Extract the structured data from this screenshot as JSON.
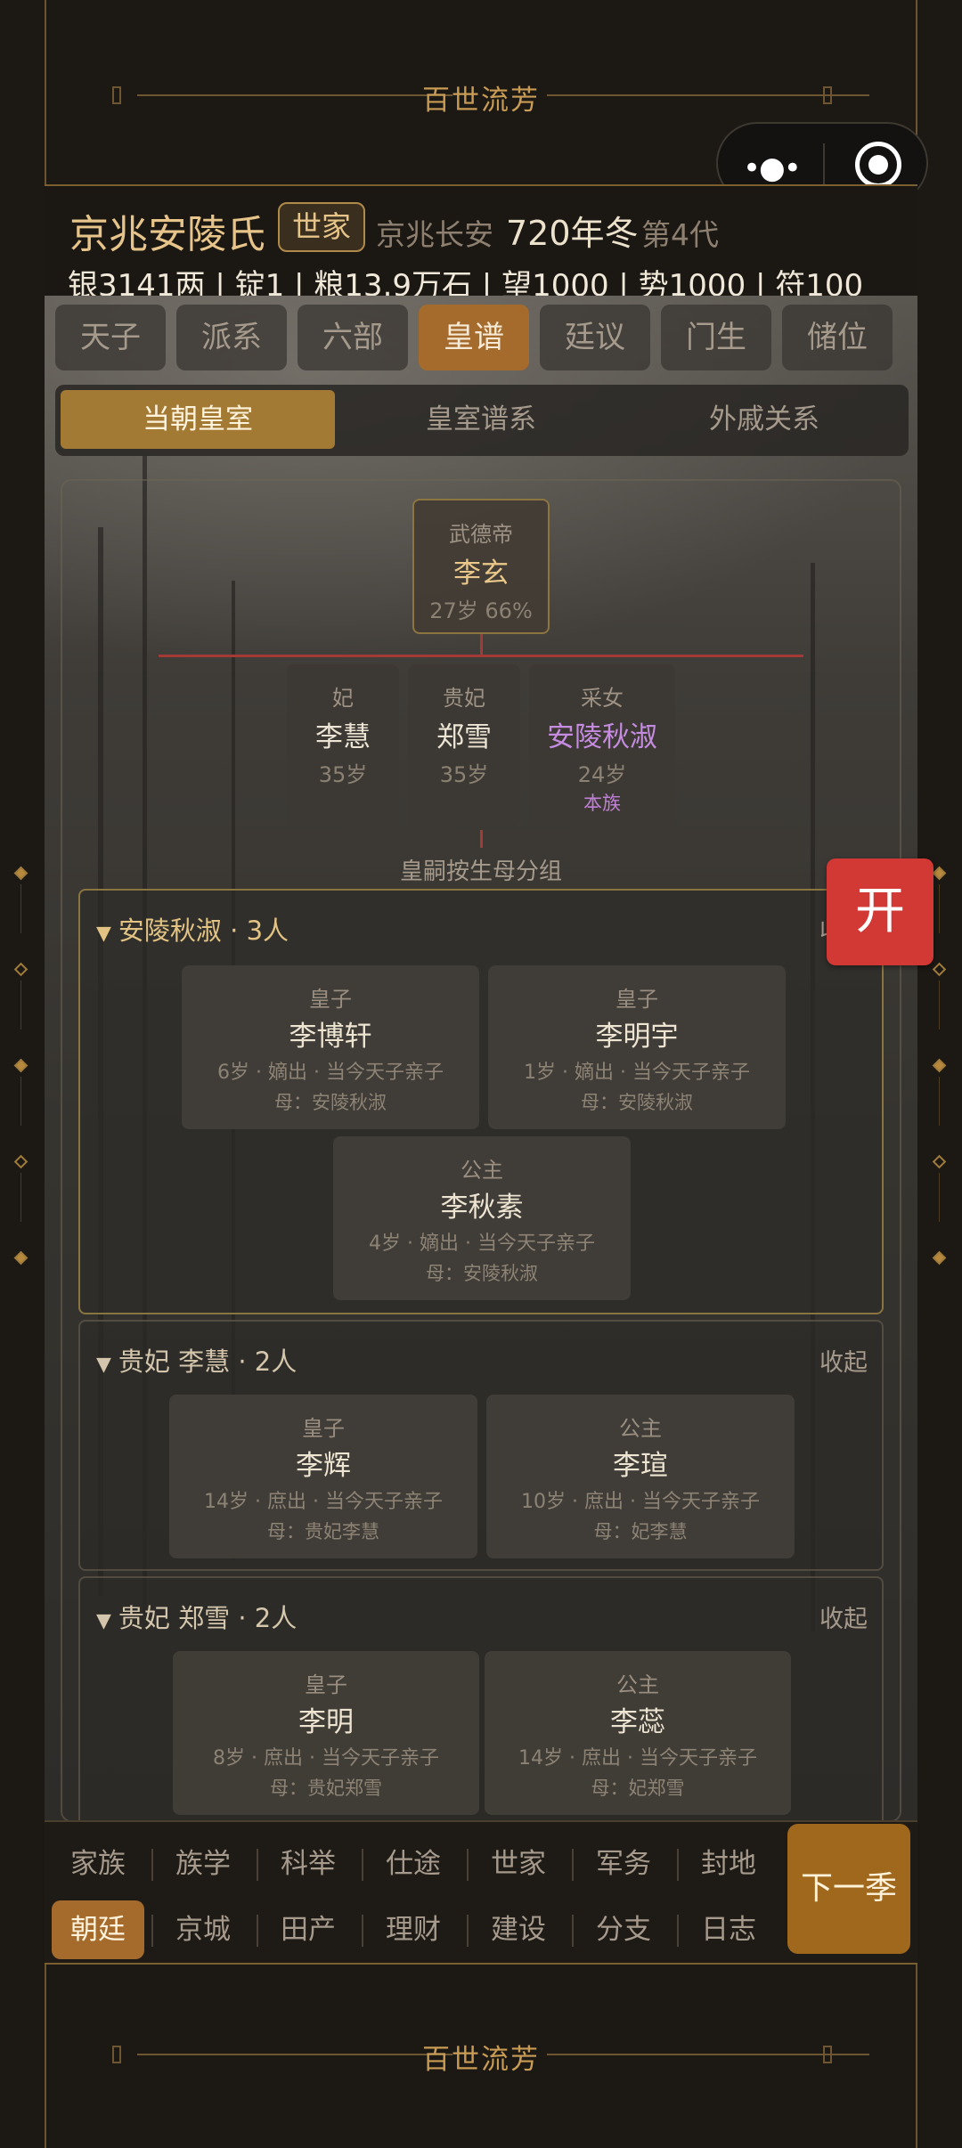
{
  "banner": {
    "text": "百世流芳"
  },
  "header": {
    "family": "京兆安陵氏",
    "rank_badge": "世家",
    "location": "京兆长安",
    "year": "720年冬",
    "generation": "第4代",
    "resources": "银3141两 | 锭1 | 粮13.9万石 | 望1000 | 势1000 | 符100"
  },
  "tabs": [
    "天子",
    "派系",
    "六部",
    "皇谱",
    "廷议",
    "门生",
    "储位"
  ],
  "active_tab": "皇谱",
  "subtabs": [
    "当朝皇室",
    "皇室谱系",
    "外戚关系"
  ],
  "active_subtab": "当朝皇室",
  "emperor": {
    "title": "武德帝",
    "name": "李玄",
    "info": "27岁 66%"
  },
  "consorts": [
    {
      "rank": "妃",
      "name": "李慧",
      "age": "35岁",
      "tag": ""
    },
    {
      "rank": "贵妃",
      "name": "郑雪",
      "age": "35岁",
      "tag": ""
    },
    {
      "rank": "采女",
      "name": "安陵秋淑",
      "age": "24岁",
      "tag": "本族"
    }
  ],
  "group_caption": "皇嗣按生母分组",
  "groups": [
    {
      "header": "安陵秋淑 · 3人",
      "collapse": "收起",
      "children": [
        {
          "role": "皇子",
          "name": "李博轩",
          "detail": "6岁 · 嫡出 · 当今天子亲子",
          "mother": "母：安陵秋淑"
        },
        {
          "role": "皇子",
          "name": "李明宇",
          "detail": "1岁 · 嫡出 · 当今天子亲子",
          "mother": "母：安陵秋淑"
        },
        {
          "role": "公主",
          "name": "李秋素",
          "detail": "4岁 · 嫡出 · 当今天子亲子",
          "mother": "母：安陵秋淑"
        }
      ]
    },
    {
      "header": "贵妃 李慧 · 2人",
      "collapse": "收起",
      "children": [
        {
          "role": "皇子",
          "name": "李辉",
          "detail": "14岁 · 庶出 · 当今天子亲子",
          "mother": "母：贵妃李慧"
        },
        {
          "role": "公主",
          "name": "李瑄",
          "detail": "10岁 · 庶出 · 当今天子亲子",
          "mother": "母：妃李慧"
        }
      ]
    },
    {
      "header": "贵妃 郑雪 · 2人",
      "collapse": "收起",
      "children": [
        {
          "role": "皇子",
          "name": "李明",
          "detail": "8岁 · 庶出 · 当今天子亲子",
          "mother": "母：贵妃郑雪"
        },
        {
          "role": "公主",
          "name": "李蕊",
          "detail": "14岁 · 庶出 · 当今天子亲子",
          "mother": "母：妃郑雪"
        }
      ]
    }
  ],
  "open_button": "开",
  "bottom_nav": {
    "row1": [
      "家族",
      "族学",
      "科举",
      "仕途",
      "世家",
      "军务",
      "封地"
    ],
    "row2": [
      "朝廷",
      "京城",
      "田产",
      "理财",
      "建设",
      "分支",
      "日志"
    ],
    "active": "朝廷",
    "next": "下一季"
  },
  "colors": {
    "accent": "#a46b2c",
    "gold": "#e6c48a",
    "red": "#d23834",
    "purple": "#c58be0"
  }
}
